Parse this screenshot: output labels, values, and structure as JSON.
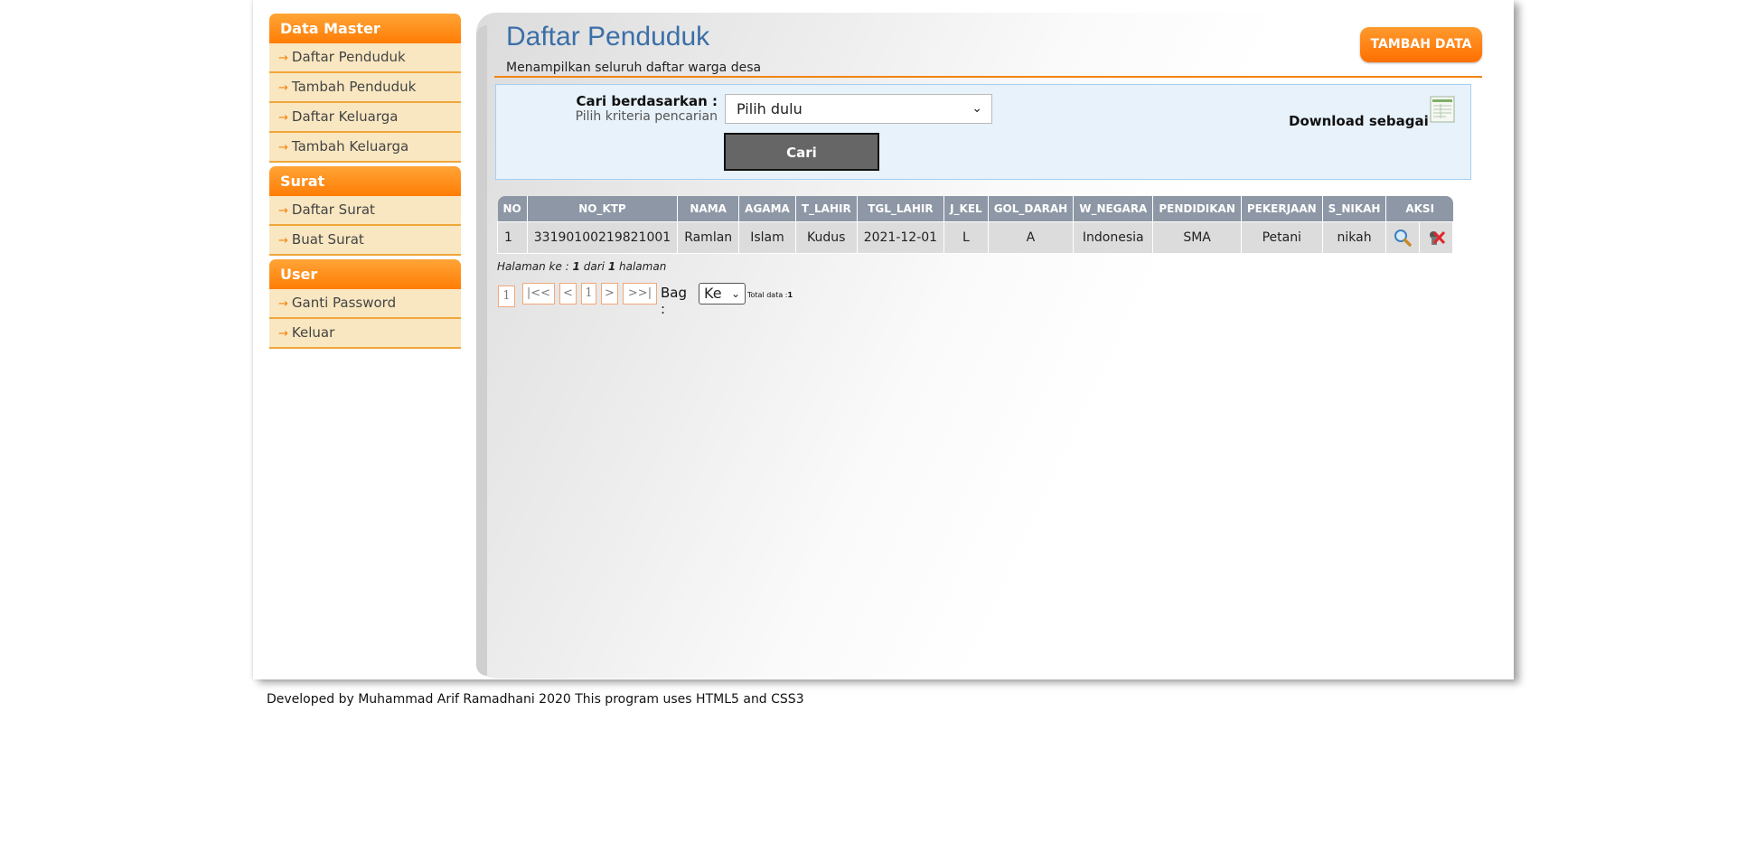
{
  "sidebar": {
    "groups": [
      {
        "title": "Data Master",
        "items": [
          {
            "label": "Daftar Penduduk"
          },
          {
            "label": "Tambah Penduduk"
          },
          {
            "label": "Daftar Keluarga"
          },
          {
            "label": "Tambah Keluarga"
          }
        ]
      },
      {
        "title": "Surat",
        "items": [
          {
            "label": "Daftar Surat"
          },
          {
            "label": "Buat Surat"
          }
        ]
      },
      {
        "title": "User",
        "items": [
          {
            "label": "Ganti Password"
          },
          {
            "label": "Keluar"
          }
        ]
      }
    ]
  },
  "header": {
    "title": "Daftar Penduduk",
    "subtitle": "Menampilkan seluruh daftar warga desa",
    "add_button": "TAMBAH DATA"
  },
  "search": {
    "label": "Cari berdasarkan :",
    "hint": "Pilih kriteria pencarian",
    "select_value": "Pilih dulu",
    "button": "Cari",
    "download_label": "Download sebagai"
  },
  "table": {
    "columns": [
      "NO",
      "NO_KTP",
      "NAMA",
      "AGAMA",
      "T_LAHIR",
      "TGL_LAHIR",
      "J_KEL",
      "GOL_DARAH",
      "W_NEGARA",
      "PENDIDIKAN",
      "PEKERJAAN",
      "S_NIKAH",
      "AKSI"
    ],
    "rows": [
      [
        "1",
        "33190100219821001",
        "Ramlan",
        "Islam",
        "Kudus",
        "2021-12-01",
        "L",
        "A",
        "Indonesia",
        "SMA",
        "Petani",
        "nikah"
      ]
    ]
  },
  "pagination": {
    "info_prefix": "Halaman ke :",
    "current": "1",
    "info_mid": "dari",
    "total_pages": "1",
    "info_suffix": "halaman",
    "current_page_box": "1",
    "first": "|<<",
    "prev": "<",
    "page": "1",
    "next": ">",
    "last": ">>|",
    "bag_label": "Bag :",
    "bag_value": "Ke",
    "total_label": "Total data :",
    "total_value": "1"
  },
  "footer": {
    "text": "Developed by Muhammad Arif Ramadhani 2020 This program uses HTML5 and CSS3"
  },
  "colors": {
    "accent": "#ff7d05",
    "title": "#3b6fa8",
    "sidebar_item_bg": "#f9e7c1",
    "table_header": "#8d97a5"
  },
  "icons": {
    "view": "magnifier-icon",
    "delete": "delete-icon",
    "download": "spreadsheet-icon",
    "arrow": "arrow-right-icon"
  }
}
